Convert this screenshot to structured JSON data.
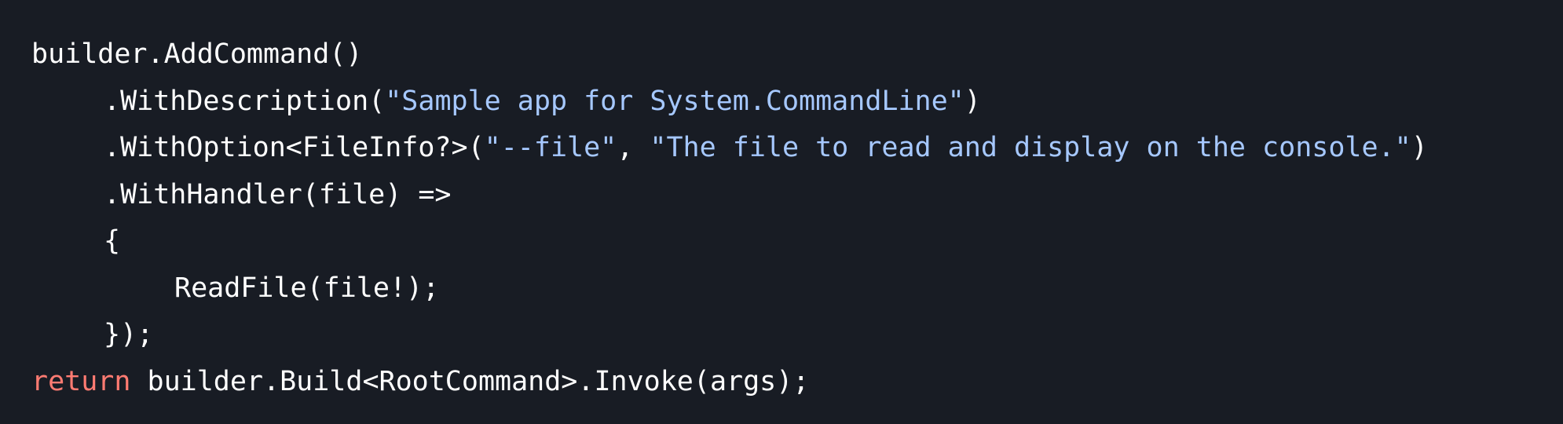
{
  "colors": {
    "background": "#181c24",
    "plain": "#ffffff",
    "string": "#a6c8ff",
    "keyword": "#ff7b72"
  },
  "code": {
    "line1": {
      "text": "builder.AddCommand()"
    },
    "line2": {
      "open": ".WithDescription(",
      "str": "\"Sample app for System.CommandLine\"",
      "close": ")"
    },
    "line3": {
      "open": ".WithOption<FileInfo?>(",
      "str1": "\"--file\"",
      "sep": ", ",
      "str2": "\"The file to read and display on the console.\"",
      "close": ")"
    },
    "line4": {
      "text": ".WithHandler(file) =>"
    },
    "line5": {
      "text": "{"
    },
    "line6": {
      "text": "ReadFile(file!);"
    },
    "line7": {
      "text": "});"
    },
    "line8": {
      "keyword": "return",
      "rest": " builder.Build<RootCommand>.Invoke(args);"
    }
  }
}
